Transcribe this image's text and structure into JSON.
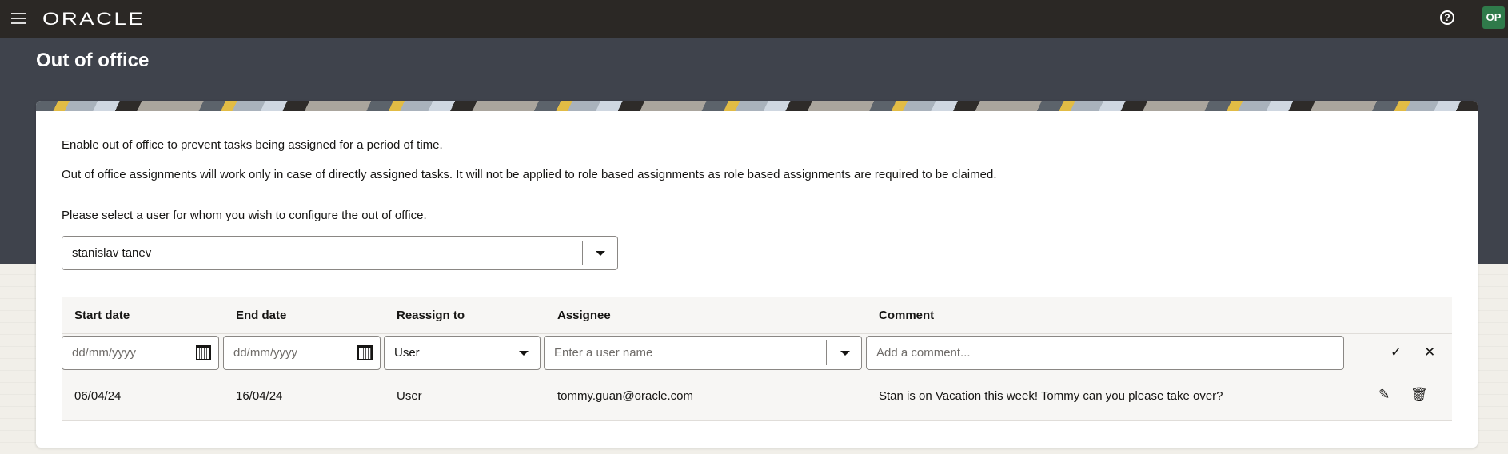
{
  "header": {
    "brand": "ORACLE",
    "help_icon": "?",
    "avatar": "OP"
  },
  "page": {
    "title": "Out of office"
  },
  "info": {
    "line1": "Enable out of office to prevent tasks being assigned for a period of time.",
    "line2": "Out of office assignments will work only in case of directly assigned tasks. It will not be applied to role based assignments as role based assignments are required to be claimed.",
    "line3": "Please select a user for whom you wish to configure the out of office."
  },
  "user_select": {
    "value": "stanislav tanev"
  },
  "table": {
    "columns": [
      "Start date",
      "End date",
      "Reassign to",
      "Assignee",
      "Comment"
    ],
    "new_row": {
      "start_placeholder": "dd/mm/yyyy",
      "end_placeholder": "dd/mm/yyyy",
      "reassign_value": "User",
      "assignee_placeholder": "Enter a  user name",
      "comment_placeholder": "Add a comment..."
    },
    "rows": [
      {
        "start": "06/04/24",
        "end": "16/04/24",
        "reassign": "User",
        "assignee": "tommy.guan@oracle.com",
        "comment": "Stan is on Vacation this week! Tommy can you please take over?"
      }
    ]
  }
}
